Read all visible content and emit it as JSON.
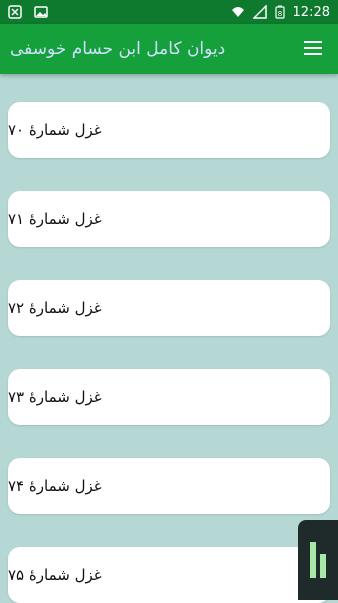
{
  "status_bar": {
    "time": "12:28",
    "battery_level": "8"
  },
  "app_bar": {
    "title": "دیوان کامل ابن حسام خوسفی",
    "menu_icon": "hamburger-menu-icon"
  },
  "list": {
    "items": [
      {
        "label": "غزل شمارهٔ ۷۰"
      },
      {
        "label": "غزل شمارهٔ ۷۱"
      },
      {
        "label": "غزل شمارهٔ ۷۲"
      },
      {
        "label": "غزل شمارهٔ ۷۳"
      },
      {
        "label": "غزل شمارهٔ ۷۴"
      },
      {
        "label": "غزل شمارهٔ ۷۵"
      }
    ]
  },
  "colors": {
    "status_bar": "#0e7a2e",
    "app_bar": "#16a03b",
    "title_text": "#cfe0ff",
    "background": "#b6d8d4",
    "card": "#ffffff"
  }
}
